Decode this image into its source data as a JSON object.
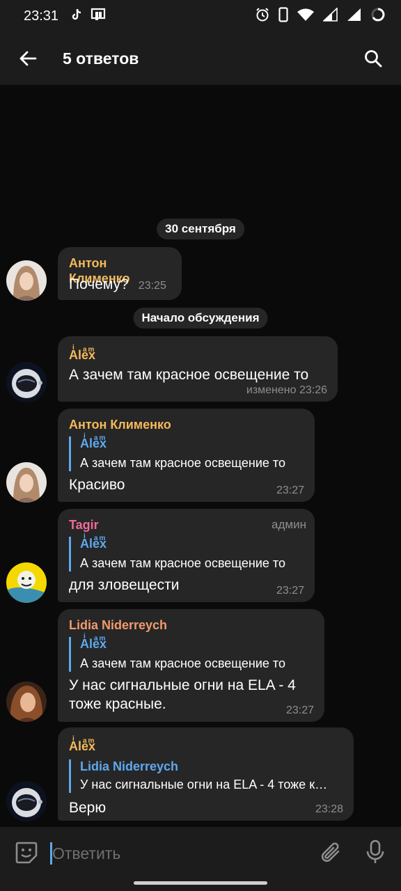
{
  "status_bar": {
    "time": "23:31"
  },
  "header": {
    "title": "5 ответов"
  },
  "chat": {
    "date_pill": "30 сентября",
    "discussion_pill": "Начало обсуждения",
    "messages": [
      {
        "sender": "Антон Клименко",
        "sender_color": "#f5b95a",
        "text": "Почему?",
        "time": "23:25"
      },
      {
        "sender": "Alex",
        "sender_sup_i": "i",
        "sender_sup_am": "am",
        "sender_color": "#f5b95a",
        "text": "А зачем там красное освещение то",
        "meta": "изменено 23:26"
      },
      {
        "sender": "Антон Клименко",
        "sender_color": "#f5b95a",
        "reply_name": "Alex",
        "reply_text": "А зачем там красное освещение то",
        "text": "Красиво",
        "time": "23:27"
      },
      {
        "sender": "Tagir",
        "sender_color": "#ef6a9a",
        "badge": "админ",
        "reply_name": "Alex",
        "reply_text": "А зачем там красное освещение то",
        "text": "для зловещести",
        "time": "23:27"
      },
      {
        "sender": "Lidia Niderreych",
        "sender_color": "#f39a6b",
        "reply_name": "Alex",
        "reply_text": "А зачем там красное освещение то",
        "text_line1": "У нас сигнальные огни на ELA - 4",
        "text_line2": "тоже красные.",
        "time": "23:27"
      },
      {
        "sender": "Alex",
        "sender_color": "#f5b95a",
        "reply_name": "Lidia Niderreych",
        "reply_text": "У нас сигнальные огни на ELA - 4 тоже к…",
        "text": "Верю",
        "time": "23:28"
      }
    ]
  },
  "input": {
    "placeholder": "Ответить"
  },
  "colors": {
    "accent": "#5ea9ef",
    "bubble": "#262626",
    "background": "#0a0a0a",
    "bar": "#1c1c1c"
  }
}
